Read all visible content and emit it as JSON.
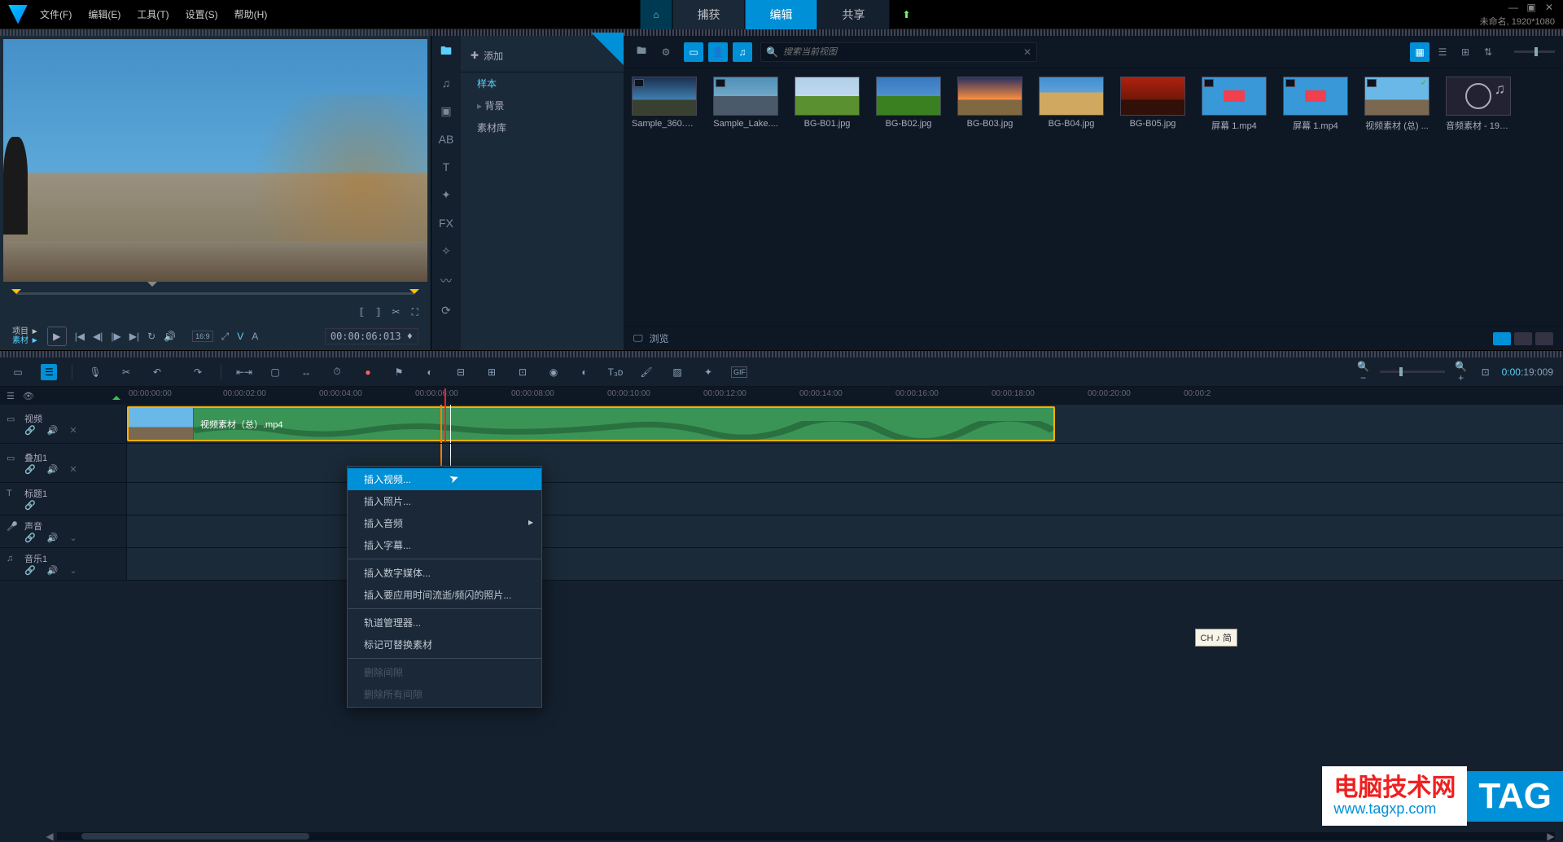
{
  "titlebar": {
    "menus": [
      "文件(F)",
      "编辑(E)",
      "工具(T)",
      "设置(S)",
      "帮助(H)"
    ],
    "tabs": {
      "capture": "捕获",
      "edit": "编辑",
      "share": "共享"
    },
    "project_info": "未命名, 1920*1080"
  },
  "preview": {
    "label_project": "项目 ►",
    "label_material": "素材 ►",
    "timecode": "00:00:06:013 ♦",
    "aspect": "16:9",
    "letters": {
      "v": "V",
      "a": "A"
    }
  },
  "library": {
    "add_label": "添加",
    "tree": {
      "sample": "样本",
      "background": "背景",
      "asset_lib": "素材库"
    },
    "search_placeholder": "搜索当前视图",
    "items": [
      {
        "name": "Sample_360.m..."
      },
      {
        "name": "Sample_Lake...."
      },
      {
        "name": "BG-B01.jpg"
      },
      {
        "name": "BG-B02.jpg"
      },
      {
        "name": "BG-B03.jpg"
      },
      {
        "name": "BG-B04.jpg"
      },
      {
        "name": "BG-B05.jpg"
      },
      {
        "name": "屏幕 1.mp4"
      },
      {
        "name": "屏幕 1.mp4"
      },
      {
        "name": "视频素材 (总) ..."
      },
      {
        "name": "音频素材 - 196..."
      }
    ],
    "browse": "浏览",
    "tools": {
      "fx": "FX",
      "ab": "AB",
      "t": "T"
    }
  },
  "timeline": {
    "duration": "0:00:19:009",
    "ruler": [
      "00:00:00:00",
      "00:00:02:00",
      "00:00:04:00",
      "00:00:06:00",
      "00:00:08:00",
      "00:00:10:00",
      "00:00:12:00",
      "00:00:14:00",
      "00:00:16:00",
      "00:00:18:00",
      "00:00:20:00",
      "00:00:2"
    ],
    "tracks": {
      "video": "视频",
      "overlay1": "叠加1",
      "title1": "标题1",
      "voice": "声音",
      "music1": "音乐1"
    },
    "clip_name": "视频素材（总）.mp4"
  },
  "context_menu": {
    "insert_video": "插入视频...",
    "insert_photo": "插入照片...",
    "insert_audio": "插入音频",
    "insert_subtitle": "插入字幕...",
    "insert_digital": "插入数字媒体...",
    "insert_timelapse": "插入要应用时间流逝/频闪的照片...",
    "track_manager": "轨道管理器...",
    "mark_replaceable": "标记可替换素材",
    "delete_gap": "删除间隙",
    "delete_all_gaps": "删除所有间隙"
  },
  "ime": "CH ♪ 简",
  "watermark": {
    "cn_title": "电脑技术网",
    "url": "www.tagxp.com",
    "tag": "TAG"
  }
}
